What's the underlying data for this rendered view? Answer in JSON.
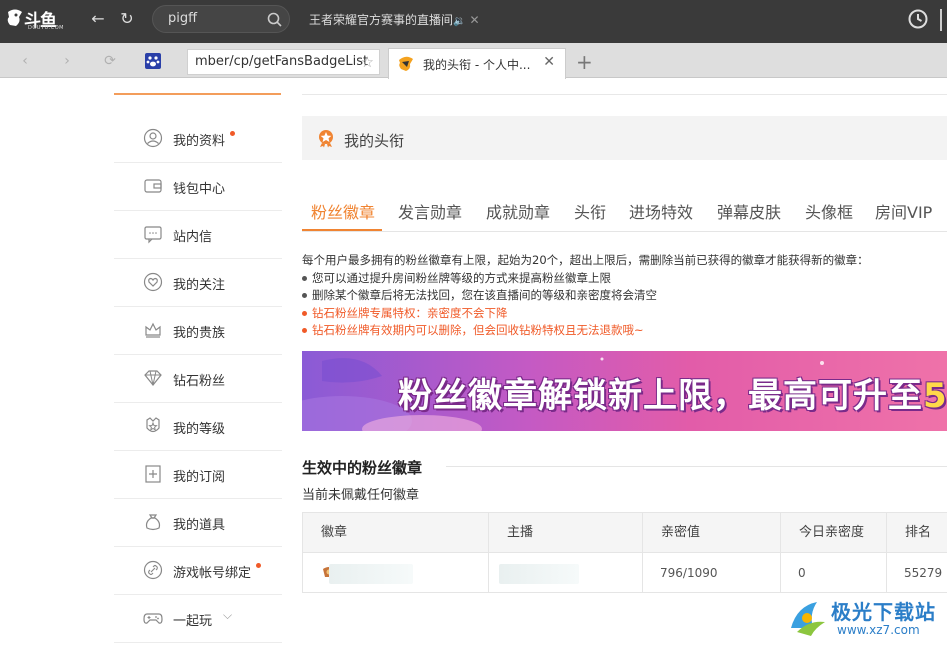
{
  "browser": {
    "logo_text": "斗鱼",
    "logo_sub": "DOUYU.COM",
    "search_value": "pigff",
    "live_title": "王者荣耀官方赛事的直播间",
    "url_text": "mber/cp/getFansBadgeList",
    "active_tab_title": "我的头衔 - 个人中...",
    "new_tab_label": "+"
  },
  "sidebar": {
    "items": [
      {
        "label": "我的资料",
        "icon": "user-icon",
        "dot": true
      },
      {
        "label": "钱包中心",
        "icon": "wallet-icon",
        "dot": false
      },
      {
        "label": "站内信",
        "icon": "message-icon",
        "dot": false
      },
      {
        "label": "我的关注",
        "icon": "heart-icon",
        "dot": false
      },
      {
        "label": "我的贵族",
        "icon": "crown-icon",
        "dot": false
      },
      {
        "label": "钻石粉丝",
        "icon": "diamond-icon",
        "dot": false
      },
      {
        "label": "我的等级",
        "icon": "level-icon",
        "dot": false
      },
      {
        "label": "我的订阅",
        "icon": "subscribe-icon",
        "dot": false
      },
      {
        "label": "我的道具",
        "icon": "bag-icon",
        "dot": false
      },
      {
        "label": "游戏帐号绑定",
        "icon": "link-icon",
        "dot": true
      },
      {
        "label": "一起玩",
        "icon": "gamepad-icon",
        "dot": false
      }
    ]
  },
  "main": {
    "title": "我的头衔",
    "tabs": [
      "粉丝徽章",
      "发言勋章",
      "成就勋章",
      "头衔",
      "进场特效",
      "弹幕皮肤",
      "头像框",
      "房间VIP"
    ],
    "active_tab": 0,
    "notes": {
      "intro": "每个用户最多拥有的粉丝徽章有上限，起始为20个，超出上限后，需删除当前已获得的徽章才能获得新的徽章：",
      "rule1": "您可以通过提升房间粉丝牌等级的方式来提高粉丝徽章上限",
      "rule2": "删除某个徽章后将无法找回，您在该直播间的等级和亲密度将会清空",
      "warn1": "钻石粉丝牌专属特权：亲密度不会下降",
      "warn2": "钻石粉丝牌有效期内可以删除，但会回收钻粉特权且无法退款哦~"
    },
    "banner": {
      "text_a": "粉丝徽章解锁新上限，最高可升至",
      "text_b": "5"
    },
    "section_title": "生效中的粉丝徽章",
    "section_sub": "当前未佩戴任何徽章",
    "table": {
      "headers": [
        "徽章",
        "主播",
        "亲密值",
        "今日亲密度",
        "排名"
      ],
      "rows": [
        {
          "intimacy": "796/1090",
          "today": "0",
          "rank": "55279"
        }
      ]
    }
  },
  "watermark": {
    "line1": "极光下载站",
    "line2": "www.xz7.com"
  },
  "colors": {
    "accent": "#f08432",
    "warn": "#f05a28",
    "topbar": "#3a3a3a",
    "watermark": "#2b7ec8"
  }
}
